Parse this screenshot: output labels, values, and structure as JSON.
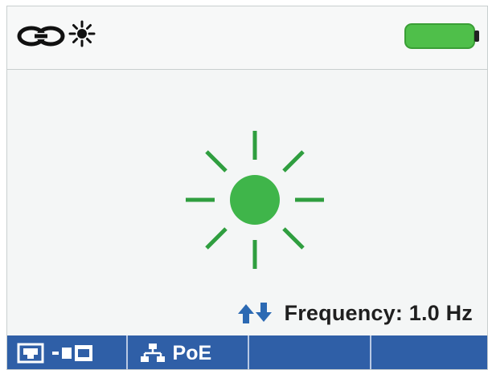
{
  "status_bar": {
    "icons": [
      "link-icon",
      "activity-icon",
      "battery-icon"
    ],
    "battery_level": 1.0
  },
  "main": {
    "activity_icon": "activity-blink-icon",
    "frequency_icon": "up-down-arrows-icon",
    "frequency_text": "Frequency: 1.0 Hz"
  },
  "softkeys": {
    "key1_icon": "port-connector-icon",
    "key2_icon": "network-icon",
    "key2_label": "PoE",
    "key3_label": "",
    "key4_label": ""
  },
  "colors": {
    "accent_green": "#3fb54a",
    "softkey_blue": "#2f5fa7",
    "arrow_blue": "#2b69b3"
  }
}
